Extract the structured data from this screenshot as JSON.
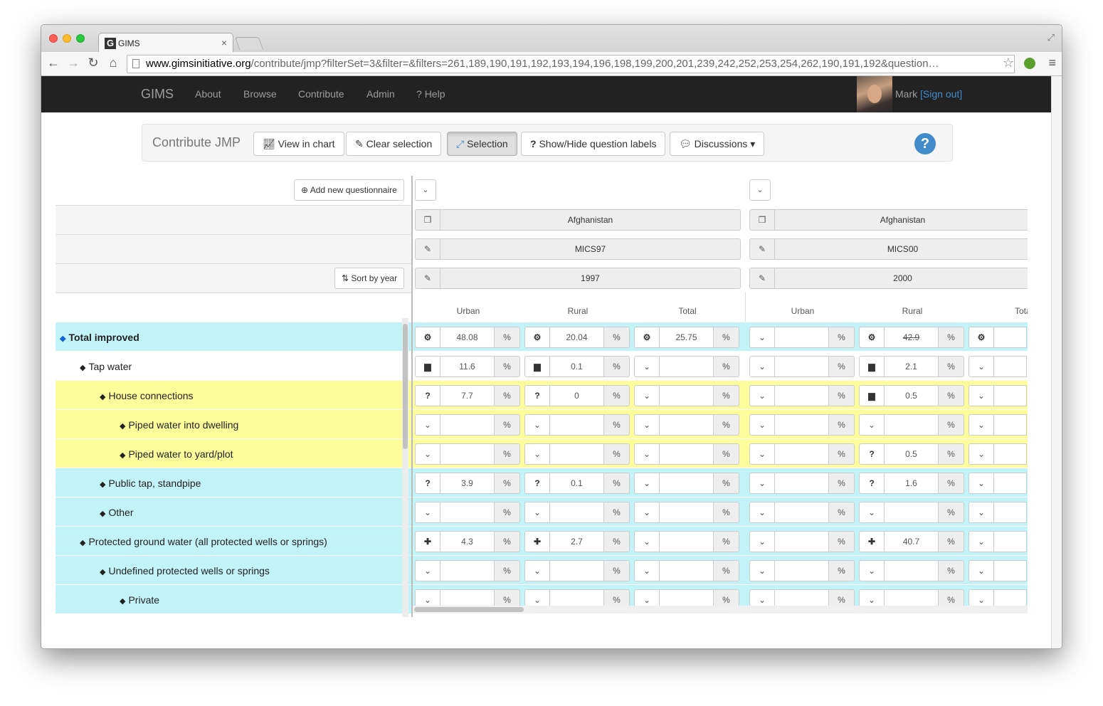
{
  "browser": {
    "tab_title": "GIMS",
    "tab_close": "×",
    "url_domain": "www.gimsinitiative.org",
    "url_path": "/contribute/jmp?filterSet=3&filter=&filters=261,189,190,191,192,193,194,196,198,199,200,201,239,242,252,253,254,262,190,191,192&question…"
  },
  "navbar": {
    "brand": "GIMS",
    "links": [
      "About",
      "Browse",
      "Contribute",
      "Admin",
      "Help"
    ],
    "user": "Mark",
    "signout": "[Sign out]"
  },
  "panel": {
    "title": "Contribute JMP",
    "buttons": [
      "View in chart",
      "Clear selection",
      "Selection",
      "Show/Hide question labels",
      "Discussions"
    ]
  },
  "grid": {
    "add_questionnaire": "Add new questionnaire",
    "sort_by_year": "Sort by year",
    "questionnaires": [
      {
        "country": "Afghanistan",
        "survey": "MICS97",
        "year": "1997"
      },
      {
        "country": "Afghanistan",
        "survey": "MICS00",
        "year": "2000"
      }
    ],
    "parts": [
      "Urban",
      "Rural",
      "Total"
    ],
    "last_part_cropped": "Tota",
    "pct": "%",
    "rows": [
      {
        "label": "Total improved",
        "indent": 0,
        "bold": true,
        "color": "#c2f3f8",
        "tag_color": "#1266d6",
        "cells": [
          [
            "gear",
            "48.08"
          ],
          [
            "gear",
            "20.04"
          ],
          [
            "gear",
            "25.75"
          ],
          [
            "chevron",
            ""
          ],
          [
            "gear",
            "42.9"
          ],
          [
            "gear",
            ""
          ]
        ],
        "strike": [
          4
        ]
      },
      {
        "label": "Tap water",
        "indent": 1,
        "bold": false,
        "color": "#ffffff",
        "cells": [
          [
            "folder",
            "11.6"
          ],
          [
            "folder",
            "0.1"
          ],
          [
            "chevron",
            ""
          ],
          [
            "chevron",
            ""
          ],
          [
            "folder",
            "2.1"
          ],
          [
            "chevron",
            ""
          ]
        ]
      },
      {
        "label": "House connections",
        "indent": 2,
        "bold": false,
        "color": "#fdfd9c",
        "cells": [
          [
            "question",
            "7.7"
          ],
          [
            "question",
            "0"
          ],
          [
            "chevron",
            ""
          ],
          [
            "chevron",
            ""
          ],
          [
            "folder",
            "0.5"
          ],
          [
            "chevron",
            ""
          ]
        ]
      },
      {
        "label": "Piped water into dwelling",
        "indent": 3,
        "bold": false,
        "color": "#fdfd9c",
        "cells": [
          [
            "chevron",
            ""
          ],
          [
            "chevron",
            ""
          ],
          [
            "chevron",
            ""
          ],
          [
            "chevron",
            ""
          ],
          [
            "chevron",
            ""
          ],
          [
            "chevron",
            ""
          ]
        ]
      },
      {
        "label": "Piped water to yard/plot",
        "indent": 3,
        "bold": false,
        "color": "#fdfd9c",
        "cells": [
          [
            "chevron",
            ""
          ],
          [
            "chevron",
            ""
          ],
          [
            "chevron",
            ""
          ],
          [
            "chevron",
            ""
          ],
          [
            "question",
            "0.5"
          ],
          [
            "chevron",
            ""
          ]
        ]
      },
      {
        "label": "Public tap, standpipe",
        "indent": 2,
        "bold": false,
        "color": "#c2f3f8",
        "cells": [
          [
            "question",
            "3.9"
          ],
          [
            "question",
            "0.1"
          ],
          [
            "chevron",
            ""
          ],
          [
            "chevron",
            ""
          ],
          [
            "question",
            "1.6"
          ],
          [
            "chevron",
            ""
          ]
        ]
      },
      {
        "label": "Other",
        "indent": 2,
        "bold": false,
        "color": "#c2f3f8",
        "cells": [
          [
            "chevron",
            ""
          ],
          [
            "chevron",
            ""
          ],
          [
            "chevron",
            ""
          ],
          [
            "chevron",
            ""
          ],
          [
            "chevron",
            ""
          ],
          [
            "chevron",
            ""
          ]
        ]
      },
      {
        "label": "Protected ground water (all protected wells or springs)",
        "indent": 1,
        "bold": false,
        "color": "#c2f3f8",
        "cells": [
          [
            "plus",
            "4.3"
          ],
          [
            "plus",
            "2.7"
          ],
          [
            "chevron",
            ""
          ],
          [
            "chevron",
            ""
          ],
          [
            "plus",
            "40.7"
          ],
          [
            "chevron",
            ""
          ]
        ]
      },
      {
        "label": "Undefined protected wells or springs",
        "indent": 2,
        "bold": false,
        "color": "#c2f3f8",
        "cells": [
          [
            "chevron",
            ""
          ],
          [
            "chevron",
            ""
          ],
          [
            "chevron",
            ""
          ],
          [
            "chevron",
            ""
          ],
          [
            "chevron",
            ""
          ],
          [
            "chevron",
            ""
          ]
        ]
      },
      {
        "label": "Private",
        "indent": 3,
        "bold": false,
        "color": "#c2f3f8",
        "cells": [
          [
            "chevron",
            ""
          ],
          [
            "chevron",
            ""
          ],
          [
            "chevron",
            ""
          ],
          [
            "chevron",
            ""
          ],
          [
            "chevron",
            ""
          ],
          [
            "chevron",
            ""
          ]
        ]
      }
    ]
  }
}
